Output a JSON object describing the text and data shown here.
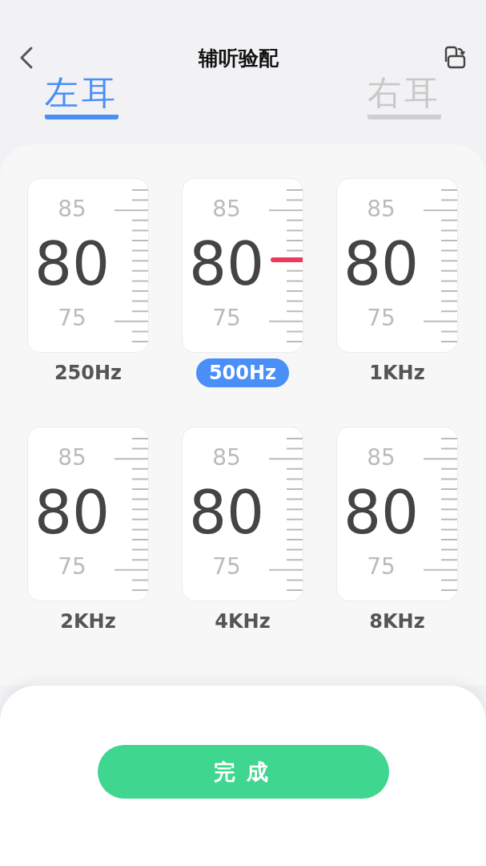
{
  "header": {
    "title": "辅听验配"
  },
  "ears": [
    {
      "label": "左耳",
      "selected": true
    },
    {
      "label": "右耳",
      "selected": false
    }
  ],
  "bands": [
    {
      "upper": "85",
      "value": "80",
      "lower": "75",
      "label": "250Hz",
      "selected": false
    },
    {
      "upper": "85",
      "value": "80",
      "lower": "75",
      "label": "500Hz",
      "selected": true
    },
    {
      "upper": "85",
      "value": "80",
      "lower": "75",
      "label": "1KHz",
      "selected": false
    },
    {
      "upper": "85",
      "value": "80",
      "lower": "75",
      "label": "2KHz",
      "selected": false
    },
    {
      "upper": "85",
      "value": "80",
      "lower": "75",
      "label": "4KHz",
      "selected": false
    },
    {
      "upper": "85",
      "value": "80",
      "lower": "75",
      "label": "8KHz",
      "selected": false
    }
  ],
  "done_button": {
    "label": "完成"
  }
}
